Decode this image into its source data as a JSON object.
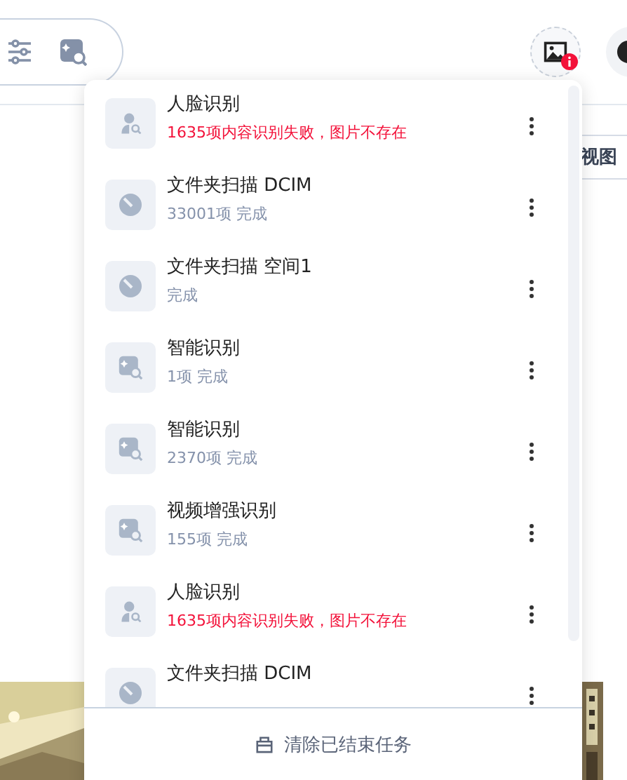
{
  "toolbar": {
    "notification": true,
    "view_button": "视图"
  },
  "tasks": [
    {
      "kind": "face",
      "title": "人脸识别",
      "failed": true,
      "detail": "1635项内容识别失败，图片不存在"
    },
    {
      "kind": "folder",
      "title": "文件夹扫描 DCIM",
      "failed": false,
      "detail": "33001项 完成"
    },
    {
      "kind": "folder",
      "title": "文件夹扫描 空间1",
      "failed": false,
      "detail": "完成"
    },
    {
      "kind": "smart",
      "title": "智能识别",
      "failed": false,
      "detail": "1项 完成"
    },
    {
      "kind": "smart",
      "title": "智能识别",
      "failed": false,
      "detail": "2370项 完成"
    },
    {
      "kind": "smart",
      "title": "视频增强识别",
      "failed": false,
      "detail": "155项 完成"
    },
    {
      "kind": "face",
      "title": "人脸识别",
      "failed": true,
      "detail": "1635项内容识别失败，图片不存在"
    },
    {
      "kind": "folder",
      "title": "文件夹扫描 DCIM"
    }
  ],
  "footer": "清除已结束任务"
}
